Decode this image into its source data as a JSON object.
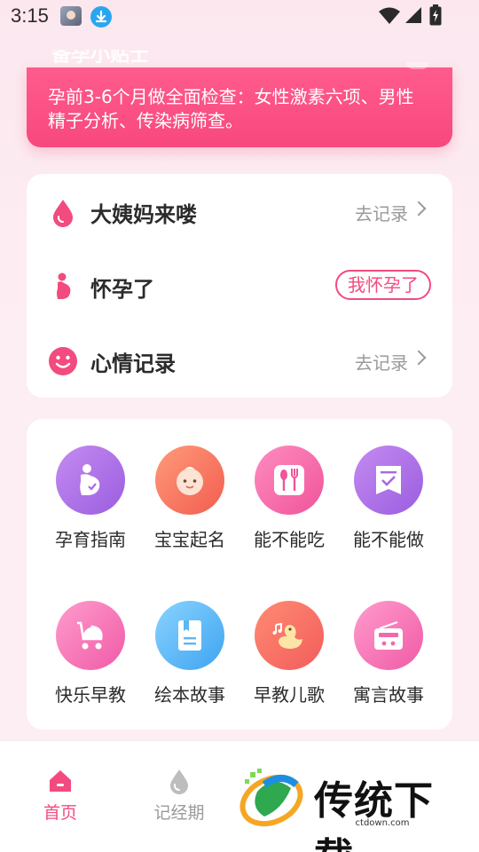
{
  "status_bar": {
    "time": "3:15"
  },
  "banner": {
    "title_partial": "备孕小贴士",
    "text": "孕前3-6个月做全面检查：女性激素六项、男性精子分析、传染病筛查。"
  },
  "records": [
    {
      "label": "大姨妈来喽",
      "action": "去记录",
      "icon": "drop-icon"
    },
    {
      "label": "怀孕了",
      "action": "我怀孕了",
      "icon": "pregnant-icon"
    },
    {
      "label": "心情记录",
      "action": "去记录",
      "icon": "smile-icon"
    }
  ],
  "tools": [
    {
      "label": "孕育指南",
      "icon": "pregnancy-guide-icon"
    },
    {
      "label": "宝宝起名",
      "icon": "baby-face-icon"
    },
    {
      "label": "能不能吃",
      "icon": "fork-spoon-icon"
    },
    {
      "label": "能不能做",
      "icon": "checklist-icon"
    },
    {
      "label": "快乐早教",
      "icon": "stroller-icon"
    },
    {
      "label": "绘本故事",
      "icon": "book-icon"
    },
    {
      "label": "早教儿歌",
      "icon": "duck-music-icon"
    },
    {
      "label": "寓言故事",
      "icon": "radio-icon"
    }
  ],
  "bottom_nav": {
    "home": "首页",
    "record": "记经期"
  },
  "watermark": {
    "text": "传统下载",
    "url": "ctdown.com"
  },
  "colors": {
    "accent": "#f24b7f",
    "banner": "#f8487d"
  }
}
